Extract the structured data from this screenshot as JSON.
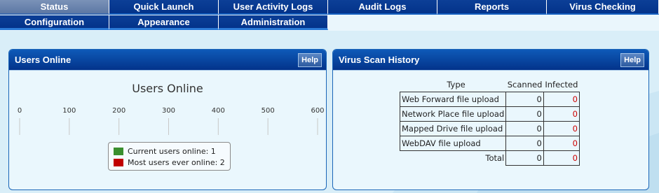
{
  "nav": {
    "row1": [
      "Status",
      "Quick Launch",
      "User Activity Logs",
      "Audit Logs",
      "Reports",
      "Virus Checking"
    ],
    "row2": [
      "Configuration",
      "Appearance",
      "Administration"
    ],
    "active": "Status"
  },
  "users_panel": {
    "title": "Users Online",
    "help": "Help",
    "chart_title": "Users Online",
    "ticks": [
      "0",
      "100",
      "200",
      "300",
      "400",
      "500",
      "600"
    ],
    "legend": [
      {
        "label": "Current users online: 1",
        "color": "#3a8f2e"
      },
      {
        "label": "Most users ever online: 2",
        "color": "#c00000"
      }
    ]
  },
  "chart_data": {
    "type": "bar",
    "title": "Users Online",
    "xlim": [
      0,
      600
    ],
    "series": [
      {
        "name": "Current users online",
        "values": [
          1
        ]
      },
      {
        "name": "Most users ever online",
        "values": [
          2
        ]
      }
    ],
    "legend_position": "bottom"
  },
  "virus_panel": {
    "title": "Virus Scan History",
    "help": "Help",
    "headers": {
      "type": "Type",
      "scanned": "Scanned",
      "infected": "Infected"
    },
    "rows": [
      {
        "type": "Web Forward file upload",
        "scanned": "0",
        "infected": "0"
      },
      {
        "type": "Network Place file upload",
        "scanned": "0",
        "infected": "0"
      },
      {
        "type": "Mapped Drive file upload",
        "scanned": "0",
        "infected": "0"
      },
      {
        "type": "WebDAV file upload",
        "scanned": "0",
        "infected": "0"
      }
    ],
    "total": {
      "label": "Total",
      "scanned": "0",
      "infected": "0"
    }
  }
}
